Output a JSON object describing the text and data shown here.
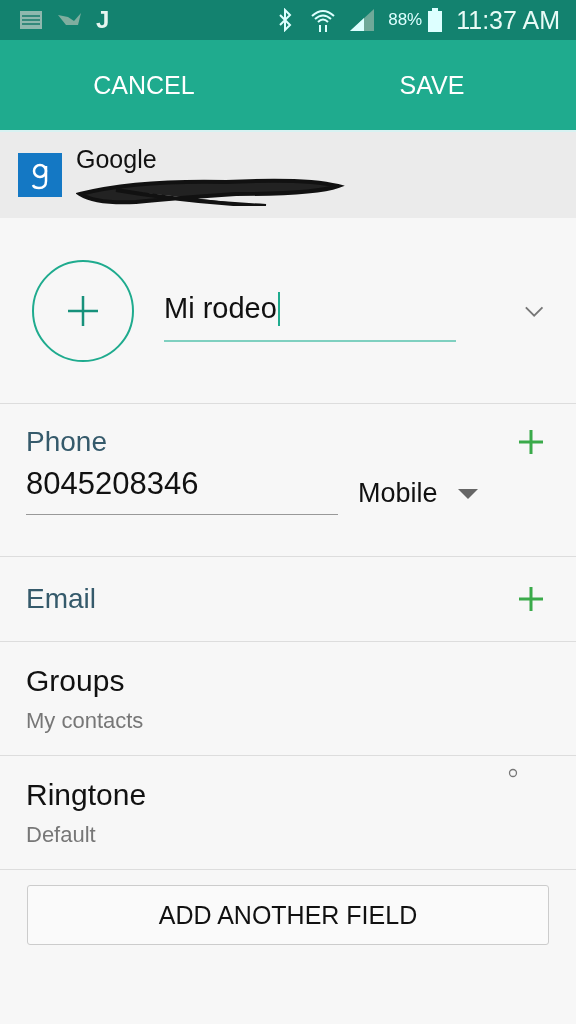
{
  "status_bar": {
    "notification_glyph": "J",
    "battery": "88%",
    "time": "11:37 AM"
  },
  "action_bar": {
    "buttons": [
      "CANCEL",
      "SAVE"
    ]
  },
  "account": {
    "name": "Google"
  },
  "name_field": {
    "value": "Mi rodeo",
    "expanded": false
  },
  "sections": [
    {
      "kind": "phone",
      "label": "Phone",
      "value": "8045208346",
      "type": "Mobile"
    },
    {
      "kind": "add",
      "label": "Email"
    },
    {
      "kind": "info",
      "label": "Groups",
      "value": "My contacts"
    },
    {
      "kind": "info",
      "label": "Ringtone",
      "value": "Default"
    }
  ],
  "add_field_button": "ADD ANOTHER FIELD"
}
